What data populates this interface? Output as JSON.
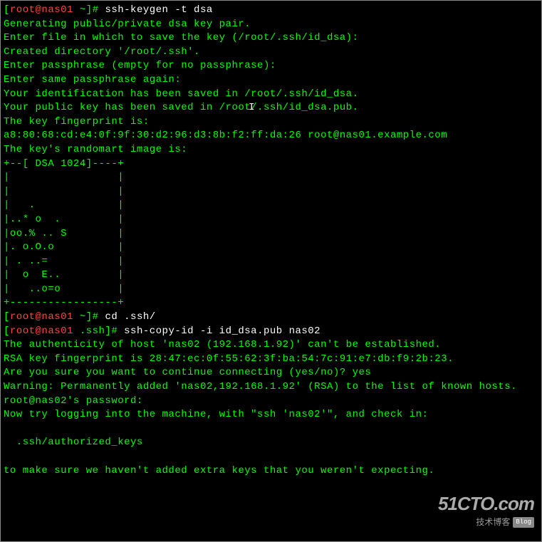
{
  "terminal": {
    "lines": [
      {
        "type": "prompt",
        "user": "root@nas01",
        "path": "~",
        "cmd": "ssh-keygen -t dsa"
      },
      {
        "type": "output",
        "text": "Generating public/private dsa key pair."
      },
      {
        "type": "output",
        "text": "Enter file in which to save the key (/root/.ssh/id_dsa):"
      },
      {
        "type": "output",
        "text": "Created directory '/root/.ssh'."
      },
      {
        "type": "output",
        "text": "Enter passphrase (empty for no passphrase):"
      },
      {
        "type": "output",
        "text": "Enter same passphrase again:"
      },
      {
        "type": "output",
        "text": "Your identification has been saved in /root/.ssh/id_dsa."
      },
      {
        "type": "output",
        "text": "Your public key has been saved in /root/.ssh/id_dsa.pub."
      },
      {
        "type": "output",
        "text": "The key fingerprint is:"
      },
      {
        "type": "output",
        "text": "a8:80:68:cd:e4:0f:9f:30:d2:96:d3:8b:f2:ff:da:26 root@nas01.example.com"
      },
      {
        "type": "output",
        "text": "The key's randomart image is:"
      },
      {
        "type": "output",
        "text": "+--[ DSA 1024]----+"
      },
      {
        "type": "output",
        "text": "|                 |"
      },
      {
        "type": "output",
        "text": "|                 |"
      },
      {
        "type": "output",
        "text": "|   .             |"
      },
      {
        "type": "output",
        "text": "|..* o  .         |"
      },
      {
        "type": "output",
        "text": "|oo.% .. S        |"
      },
      {
        "type": "output",
        "text": "|. o.O.o          |"
      },
      {
        "type": "output",
        "text": "| . ..=           |"
      },
      {
        "type": "output",
        "text": "|  o  E..         |"
      },
      {
        "type": "output",
        "text": "|   ..o=o         |"
      },
      {
        "type": "output",
        "text": "+-----------------+"
      },
      {
        "type": "prompt",
        "user": "root@nas01",
        "path": "~",
        "cmd": "cd .ssh/"
      },
      {
        "type": "prompt",
        "user": "root@nas01",
        "path": ".ssh",
        "cmd": "ssh-copy-id -i id_dsa.pub nas02"
      },
      {
        "type": "output",
        "text": "The authenticity of host 'nas02 (192.168.1.92)' can't be established."
      },
      {
        "type": "output",
        "text": "RSA key fingerprint is 28:47:ec:0f:55:62:3f:ba:54:7c:91:e7:db:f9:2b:23."
      },
      {
        "type": "output",
        "text": "Are you sure you want to continue connecting (yes/no)? yes"
      },
      {
        "type": "output",
        "text": "Warning: Permanently added 'nas02,192.168.1.92' (RSA) to the list of known hosts."
      },
      {
        "type": "output",
        "text": "root@nas02's password:"
      },
      {
        "type": "output",
        "text": "Now try logging into the machine, with \"ssh 'nas02'\", and check in:"
      },
      {
        "type": "output",
        "text": ""
      },
      {
        "type": "output",
        "text": "  .ssh/authorized_keys"
      },
      {
        "type": "output",
        "text": ""
      },
      {
        "type": "output",
        "text": "to make sure we haven't added extra keys that you weren't expecting."
      }
    ]
  },
  "watermark": {
    "main": "51CTO.com",
    "sub": "技术博客",
    "blog": "Blog"
  },
  "cursor_position": {
    "line": 8,
    "after_text": "Your public key has been saved in /root"
  }
}
